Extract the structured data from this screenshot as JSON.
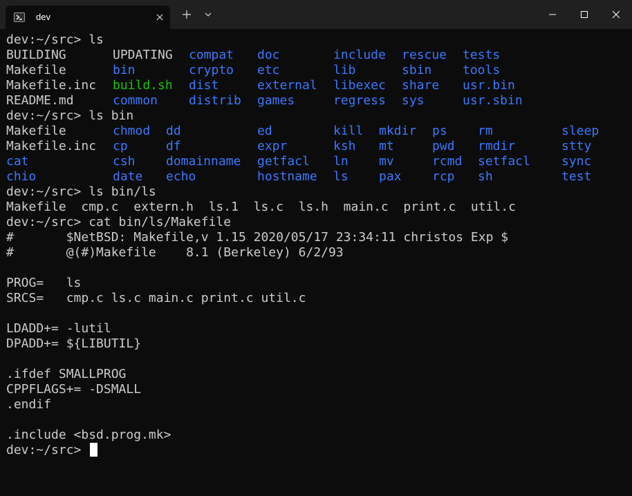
{
  "window": {
    "tab_title": "dev",
    "tab_icon": "powershell-icon",
    "colors": {
      "background": "#0c0c0c",
      "titlebar": "#202020",
      "text": "#cccccc",
      "directory": "#3b78ff",
      "executable": "#16c60c",
      "cursor": "#ffffff"
    }
  },
  "terminal": {
    "prompt1": "dev:~/src> ls",
    "ls_src": [
      [
        "BUILDING",
        "UPDATING",
        "compat",
        "doc",
        "include",
        "rescue",
        "tests"
      ],
      [
        "Makefile",
        "bin",
        "crypto",
        "etc",
        "lib",
        "sbin",
        "tools"
      ],
      [
        "Makefile.inc",
        "build.sh",
        "dist",
        "external",
        "libexec",
        "share",
        "usr.bin"
      ],
      [
        "README.md",
        "common",
        "distrib",
        "games",
        "regress",
        "sys",
        "usr.sbin"
      ]
    ],
    "prompt2": "dev:~/src> ls bin",
    "ls_bin": [
      [
        "Makefile",
        "chmod",
        "dd",
        "ed",
        "kill",
        "mkdir",
        "ps",
        "rm",
        "sleep"
      ],
      [
        "Makefile.inc",
        "cp",
        "df",
        "expr",
        "ksh",
        "mt",
        "pwd",
        "rmdir",
        "stty"
      ],
      [
        "cat",
        "csh",
        "domainname",
        "getfacl",
        "ln",
        "mv",
        "rcmd",
        "setfacl",
        "sync"
      ],
      [
        "chio",
        "date",
        "echo",
        "hostname",
        "ls",
        "pax",
        "rcp",
        "sh",
        "test"
      ]
    ],
    "prompt3": "dev:~/src> ls bin/ls",
    "ls_bin_ls": "Makefile  cmp.c  extern.h  ls.1  ls.c  ls.h  main.c  print.c  util.c",
    "prompt4": "dev:~/src> cat bin/ls/Makefile",
    "makefile": [
      "#       $NetBSD: Makefile,v 1.15 2020/05/17 23:34:11 christos Exp $",
      "#       @(#)Makefile    8.1 (Berkeley) 6/2/93",
      "",
      "PROG=   ls",
      "SRCS=   cmp.c ls.c main.c print.c util.c",
      "",
      "LDADD+= -lutil",
      "DPADD+= ${LIBUTIL}",
      "",
      ".ifdef SMALLPROG",
      "CPPFLAGS+= -DSMALL",
      ".endif",
      "",
      ".include <bsd.prog.mk>"
    ],
    "prompt5": "dev:~/src> "
  }
}
